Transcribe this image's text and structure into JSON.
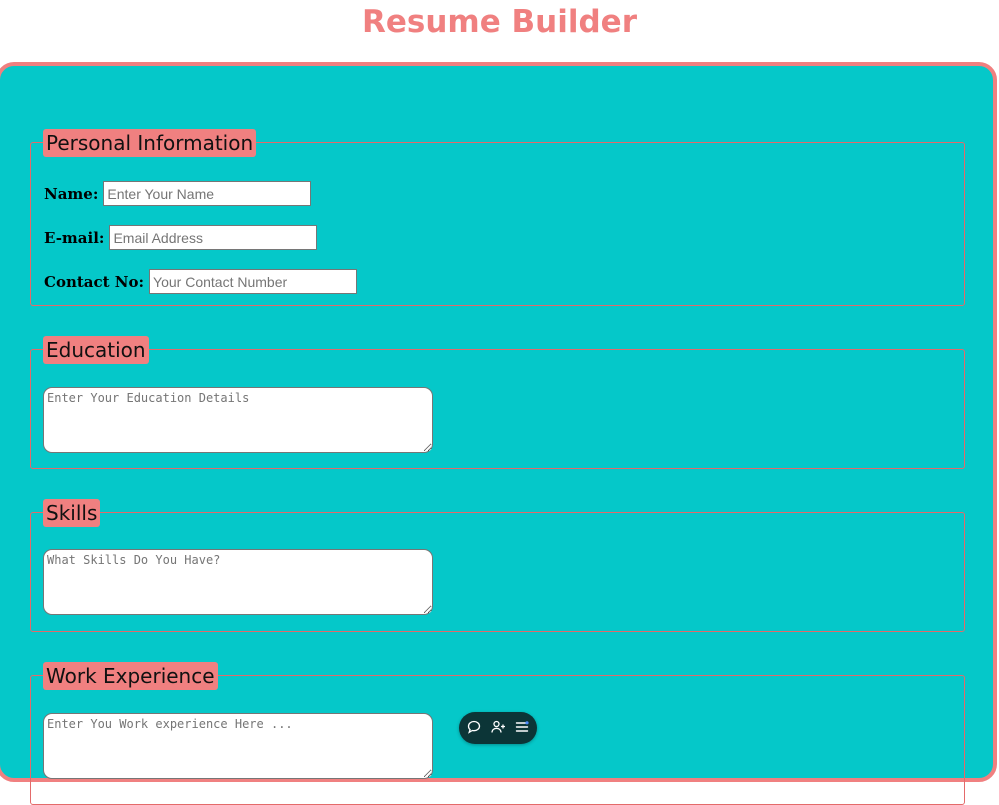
{
  "page": {
    "title": "Resume Builder"
  },
  "personal": {
    "legend": "Personal Information",
    "name_label": "Name:",
    "name_placeholder": "Enter Your Name",
    "email_label": "E-mail:",
    "email_placeholder": "Email Address",
    "contact_label": "Contact No:",
    "contact_placeholder": "Your Contact Number"
  },
  "education": {
    "legend": "Education",
    "placeholder": "Enter Your Education Details"
  },
  "skills": {
    "legend": "Skills",
    "placeholder": "What Skills Do You Have?"
  },
  "work": {
    "legend": "Work Experience",
    "placeholder": "Enter You Work experience Here ..."
  },
  "toolbar": {
    "icons": [
      "comment-icon",
      "add-user-icon",
      "menu-icon"
    ]
  },
  "colors": {
    "accent": "#f08080",
    "panel_bg": "#05c8c9",
    "toolbar_bg": "#0c3537"
  }
}
